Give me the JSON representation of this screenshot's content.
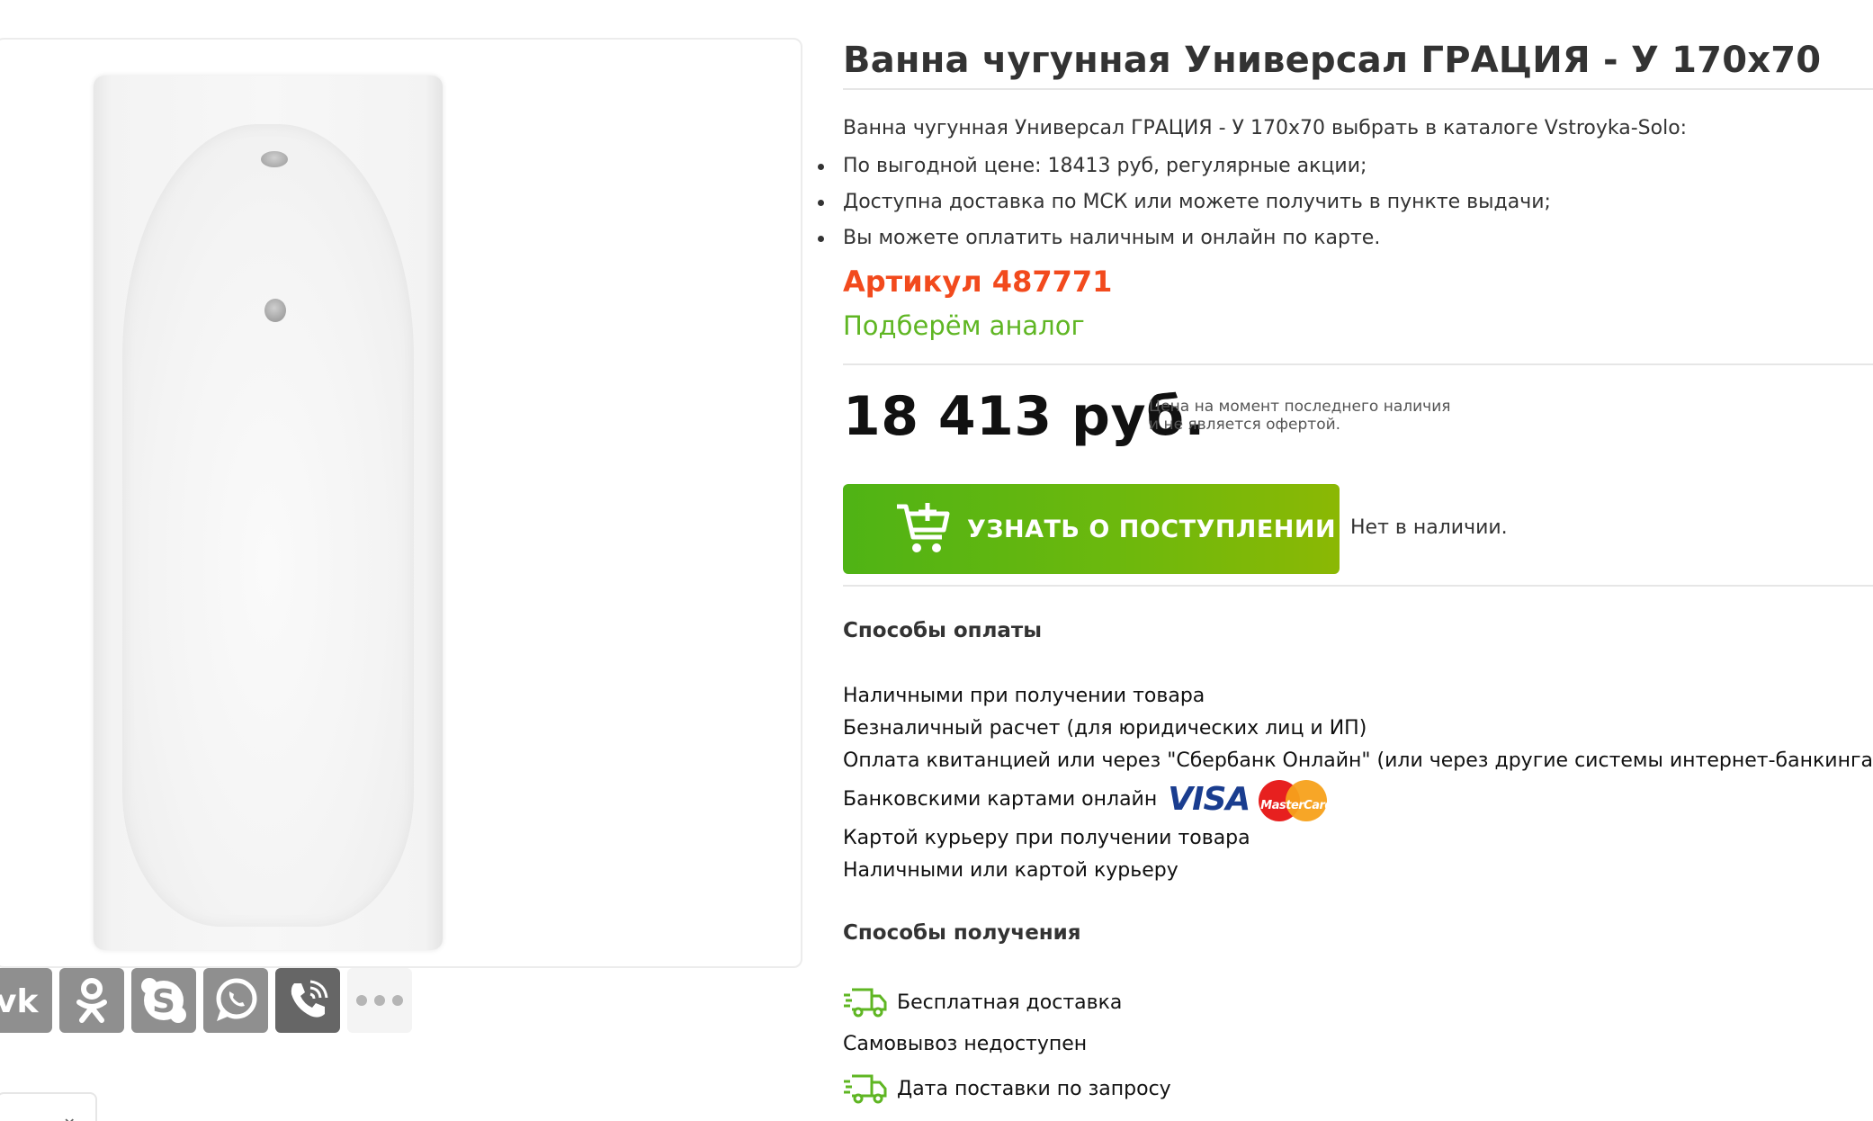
{
  "product": {
    "title": "Ванна чугунная Универсал ГРАЦИЯ - У 170x70",
    "intro": "Ванна чугунная Универсал ГРАЦИЯ - У 170x70 выбрать в каталоге Vstroyka-Solo:",
    "bullets": [
      "По выгодной цене: 18413 руб, регулярные акции;",
      "Доступна доставка по МСК или можете получить в пункте выдачи;",
      "Вы можете оплатить наличным и онлайн по карте."
    ],
    "article": "Артикул 487771",
    "analog_link": "Подберём аналог"
  },
  "price": {
    "value": "18 413 руб.",
    "note_line1": "Цена на момент последнего наличия",
    "note_line2": "и не является офертой."
  },
  "notify": {
    "button_label": "УЗНАТЬ О ПОСТУПЛЕНИИ",
    "stock_status": "Нет в наличии."
  },
  "payment": {
    "heading": "Способы оплаты",
    "methods": [
      "Наличными при получении товара",
      "Безналичный расчет (для юридических лиц и ИП)",
      "Оплата квитанцией или через \"Сбербанк Онлайн\" (или через другие системы интернет-банкинга)",
      "Банковскими картами онлайн",
      "Картой курьеру при получении товара",
      "Наличными или картой курьеру"
    ],
    "card_logos": {
      "visa": "VISA",
      "mastercard": "MasterCard"
    }
  },
  "delivery": {
    "heading": "Способы получения",
    "free_delivery": "Бесплатная доставка",
    "pickup": "Самовывоз недоступен",
    "supply_date": "Дата поставки по запросу"
  },
  "share": {
    "icons": [
      "vk-icon",
      "odnoklassniki-icon",
      "skype-icon",
      "whatsapp-icon",
      "viber-icon",
      "more-icon"
    ]
  },
  "colors": {
    "accent_green": "#5fb623",
    "article_red": "#f24a1d",
    "text": "#333333"
  }
}
